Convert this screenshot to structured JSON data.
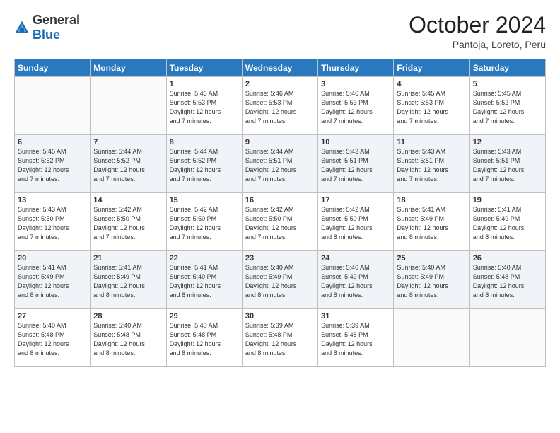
{
  "logo": {
    "general": "General",
    "blue": "Blue"
  },
  "header": {
    "month": "October 2024",
    "location": "Pantoja, Loreto, Peru"
  },
  "weekdays": [
    "Sunday",
    "Monday",
    "Tuesday",
    "Wednesday",
    "Thursday",
    "Friday",
    "Saturday"
  ],
  "weeks": [
    [
      {
        "day": "",
        "detail": ""
      },
      {
        "day": "",
        "detail": ""
      },
      {
        "day": "1",
        "detail": "Sunrise: 5:46 AM\nSunset: 5:53 PM\nDaylight: 12 hours\nand 7 minutes."
      },
      {
        "day": "2",
        "detail": "Sunrise: 5:46 AM\nSunset: 5:53 PM\nDaylight: 12 hours\nand 7 minutes."
      },
      {
        "day": "3",
        "detail": "Sunrise: 5:46 AM\nSunset: 5:53 PM\nDaylight: 12 hours\nand 7 minutes."
      },
      {
        "day": "4",
        "detail": "Sunrise: 5:45 AM\nSunset: 5:53 PM\nDaylight: 12 hours\nand 7 minutes."
      },
      {
        "day": "5",
        "detail": "Sunrise: 5:45 AM\nSunset: 5:52 PM\nDaylight: 12 hours\nand 7 minutes."
      }
    ],
    [
      {
        "day": "6",
        "detail": "Sunrise: 5:45 AM\nSunset: 5:52 PM\nDaylight: 12 hours\nand 7 minutes."
      },
      {
        "day": "7",
        "detail": "Sunrise: 5:44 AM\nSunset: 5:52 PM\nDaylight: 12 hours\nand 7 minutes."
      },
      {
        "day": "8",
        "detail": "Sunrise: 5:44 AM\nSunset: 5:52 PM\nDaylight: 12 hours\nand 7 minutes."
      },
      {
        "day": "9",
        "detail": "Sunrise: 5:44 AM\nSunset: 5:51 PM\nDaylight: 12 hours\nand 7 minutes."
      },
      {
        "day": "10",
        "detail": "Sunrise: 5:43 AM\nSunset: 5:51 PM\nDaylight: 12 hours\nand 7 minutes."
      },
      {
        "day": "11",
        "detail": "Sunrise: 5:43 AM\nSunset: 5:51 PM\nDaylight: 12 hours\nand 7 minutes."
      },
      {
        "day": "12",
        "detail": "Sunrise: 5:43 AM\nSunset: 5:51 PM\nDaylight: 12 hours\nand 7 minutes."
      }
    ],
    [
      {
        "day": "13",
        "detail": "Sunrise: 5:43 AM\nSunset: 5:50 PM\nDaylight: 12 hours\nand 7 minutes."
      },
      {
        "day": "14",
        "detail": "Sunrise: 5:42 AM\nSunset: 5:50 PM\nDaylight: 12 hours\nand 7 minutes."
      },
      {
        "day": "15",
        "detail": "Sunrise: 5:42 AM\nSunset: 5:50 PM\nDaylight: 12 hours\nand 7 minutes."
      },
      {
        "day": "16",
        "detail": "Sunrise: 5:42 AM\nSunset: 5:50 PM\nDaylight: 12 hours\nand 7 minutes."
      },
      {
        "day": "17",
        "detail": "Sunrise: 5:42 AM\nSunset: 5:50 PM\nDaylight: 12 hours\nand 8 minutes."
      },
      {
        "day": "18",
        "detail": "Sunrise: 5:41 AM\nSunset: 5:49 PM\nDaylight: 12 hours\nand 8 minutes."
      },
      {
        "day": "19",
        "detail": "Sunrise: 5:41 AM\nSunset: 5:49 PM\nDaylight: 12 hours\nand 8 minutes."
      }
    ],
    [
      {
        "day": "20",
        "detail": "Sunrise: 5:41 AM\nSunset: 5:49 PM\nDaylight: 12 hours\nand 8 minutes."
      },
      {
        "day": "21",
        "detail": "Sunrise: 5:41 AM\nSunset: 5:49 PM\nDaylight: 12 hours\nand 8 minutes."
      },
      {
        "day": "22",
        "detail": "Sunrise: 5:41 AM\nSunset: 5:49 PM\nDaylight: 12 hours\nand 8 minutes."
      },
      {
        "day": "23",
        "detail": "Sunrise: 5:40 AM\nSunset: 5:49 PM\nDaylight: 12 hours\nand 8 minutes."
      },
      {
        "day": "24",
        "detail": "Sunrise: 5:40 AM\nSunset: 5:49 PM\nDaylight: 12 hours\nand 8 minutes."
      },
      {
        "day": "25",
        "detail": "Sunrise: 5:40 AM\nSunset: 5:49 PM\nDaylight: 12 hours\nand 8 minutes."
      },
      {
        "day": "26",
        "detail": "Sunrise: 5:40 AM\nSunset: 5:48 PM\nDaylight: 12 hours\nand 8 minutes."
      }
    ],
    [
      {
        "day": "27",
        "detail": "Sunrise: 5:40 AM\nSunset: 5:48 PM\nDaylight: 12 hours\nand 8 minutes."
      },
      {
        "day": "28",
        "detail": "Sunrise: 5:40 AM\nSunset: 5:48 PM\nDaylight: 12 hours\nand 8 minutes."
      },
      {
        "day": "29",
        "detail": "Sunrise: 5:40 AM\nSunset: 5:48 PM\nDaylight: 12 hours\nand 8 minutes."
      },
      {
        "day": "30",
        "detail": "Sunrise: 5:39 AM\nSunset: 5:48 PM\nDaylight: 12 hours\nand 8 minutes."
      },
      {
        "day": "31",
        "detail": "Sunrise: 5:39 AM\nSunset: 5:48 PM\nDaylight: 12 hours\nand 8 minutes."
      },
      {
        "day": "",
        "detail": ""
      },
      {
        "day": "",
        "detail": ""
      }
    ]
  ]
}
